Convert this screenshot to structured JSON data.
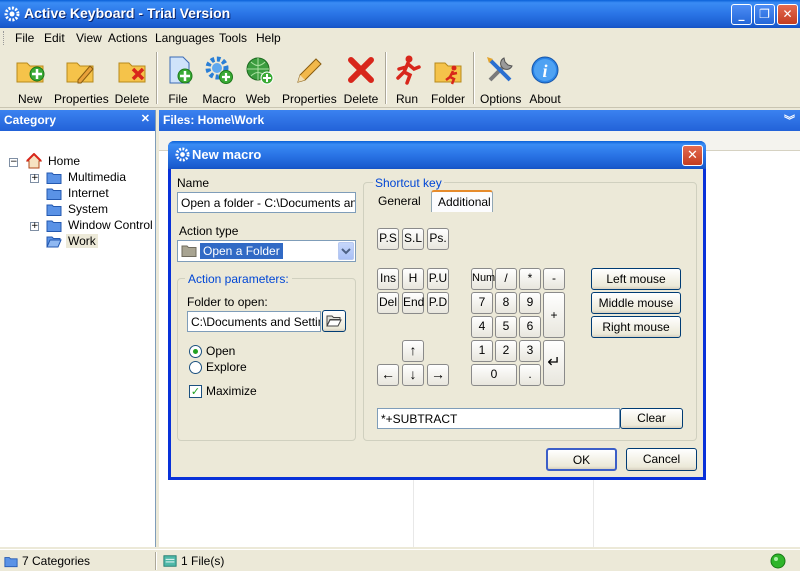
{
  "window": {
    "title": "Active Keyboard - Trial Version",
    "min": "_",
    "max": "❐",
    "close": "✕"
  },
  "menu": [
    "File",
    "Edit",
    "View",
    "Actions",
    "Languages",
    "Tools",
    "Help"
  ],
  "toolbar": {
    "new": "New",
    "properties": "Properties",
    "delete": "Delete",
    "file": "File",
    "macro": "Macro",
    "web": "Web",
    "properties2": "Properties",
    "delete2": "Delete",
    "run": "Run",
    "folder": "Folder",
    "options": "Options",
    "about": "About"
  },
  "category_panel": {
    "title": "Category",
    "pin": "✕",
    "tree": {
      "home": "Home",
      "multimedia": "Multimedia",
      "internet": "Internet",
      "system": "System",
      "window_control": "Window Control",
      "work": "Work"
    }
  },
  "files_panel": {
    "title": "Files: Home\\Work",
    "collapse": "︾"
  },
  "status": {
    "categories": "7 Categories",
    "files": "1 File(s)"
  },
  "dialog": {
    "title": "New macro",
    "close": "✕",
    "name_label": "Name",
    "name_value": "Open a folder - C:\\Documents and S",
    "action_type_label": "Action type",
    "action_type_value": "Open a Folder",
    "action_params_label": "Action parameters:",
    "folder_label": "Folder to open:",
    "folder_value": "C:\\Documents and Setting",
    "open_label": "Open",
    "explore_label": "Explore",
    "maximize_label": "Maximize",
    "open_selected": true,
    "explore_selected": false,
    "maximize_checked": true,
    "shortcut_label": "Shortcut key",
    "tab_general": "General",
    "tab_additional": "Additional",
    "keys": {
      "ps": "P.S",
      "sl": "S.L",
      "pause": "Ps.",
      "ins": "Ins",
      "home": "H",
      "pu": "P.U",
      "del": "Del",
      "end": "End",
      "pd": "P.D",
      "up": "↑",
      "left": "←",
      "down": "↓",
      "right": "→",
      "num": "Num",
      "div": "/",
      "mul": "*",
      "sub": "-",
      "n7": "7",
      "n8": "8",
      "n9": "9",
      "plus": "+",
      "n4": "4",
      "n5": "5",
      "n6": "6",
      "n1": "1",
      "n2": "2",
      "n3": "3",
      "enter": "↵",
      "n0": "0",
      "dot": "."
    },
    "mouse": {
      "left": "Left mouse",
      "middle": "Middle mouse",
      "right": "Right mouse"
    },
    "shortcut_value": "*+SUBTRACT",
    "clear": "Clear",
    "ok": "OK",
    "cancel": "Cancel"
  }
}
